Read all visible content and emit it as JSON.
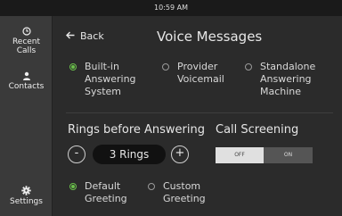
{
  "status_bar": {
    "time": "10:59 AM"
  },
  "sidebar": {
    "items": [
      {
        "label": "Recent\nCalls",
        "icon": "clock-icon"
      },
      {
        "label": "Contacts",
        "icon": "person-icon"
      },
      {
        "label": "Settings",
        "icon": "gear-icon"
      }
    ]
  },
  "header": {
    "back_label": "Back",
    "title": "Voice Messages"
  },
  "voicemail_options": {
    "selected": "Built-in Answering System",
    "items": [
      {
        "label": "Built-in\nAnswering\nSystem",
        "selected": true
      },
      {
        "label": "Provider\nVoicemail",
        "selected": false
      },
      {
        "label": "Standalone\nAnswering\nMachine",
        "selected": false
      }
    ]
  },
  "rings": {
    "label": "Rings before Answering",
    "value": "3 Rings",
    "minus": "-",
    "plus": "+"
  },
  "call_screening": {
    "label": "Call Screening",
    "off_label": "OFF",
    "on_label": "ON",
    "state": "OFF"
  },
  "greeting_options": {
    "items": [
      {
        "label": "Default\nGreeting",
        "selected": true
      },
      {
        "label": "Custom\nGreeting",
        "selected": false
      }
    ]
  },
  "colors": {
    "accent": "#6abf4b",
    "background": "#2b2b2b",
    "sidebar": "#3a3a3a"
  }
}
